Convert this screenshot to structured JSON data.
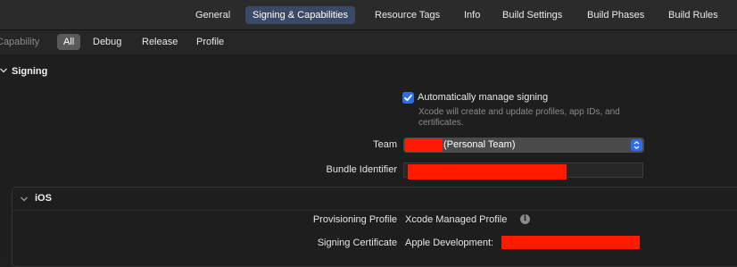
{
  "tabs": [
    {
      "label": "General",
      "active": false
    },
    {
      "label": "Signing & Capabilities",
      "active": true
    },
    {
      "label": "Resource Tags",
      "active": false
    },
    {
      "label": "Info",
      "active": false
    },
    {
      "label": "Build Settings",
      "active": false
    },
    {
      "label": "Build Phases",
      "active": false
    },
    {
      "label": "Build Rules",
      "active": false
    }
  ],
  "filterbar": {
    "capability_label": "Capability",
    "filters": [
      {
        "label": "All",
        "active": true
      },
      {
        "label": "Debug",
        "active": false
      },
      {
        "label": "Release",
        "active": false
      },
      {
        "label": "Profile",
        "active": false
      }
    ]
  },
  "signing": {
    "title": "Signing",
    "auto_manage": {
      "label": "Automatically manage signing",
      "checked": true,
      "help": "Xcode will create and update profiles, app IDs, and certificates."
    },
    "team": {
      "label": "Team",
      "value": "(Personal Team)"
    },
    "bundle": {
      "label": "Bundle Identifier"
    }
  },
  "ios": {
    "title": "iOS",
    "provisioning": {
      "label": "Provisioning Profile",
      "value": "Xcode Managed Profile"
    },
    "certificate": {
      "label": "Signing Certificate",
      "value": "Apple Development:"
    }
  },
  "colors": {
    "accent": "#2d6ee8",
    "active_tab": "#3a4a66",
    "redaction": "#ff1a00",
    "background": "#1e1e1e"
  },
  "icons": [
    "chevron-down-icon",
    "checkmark-icon",
    "updown-arrows-icon",
    "info-icon"
  ]
}
